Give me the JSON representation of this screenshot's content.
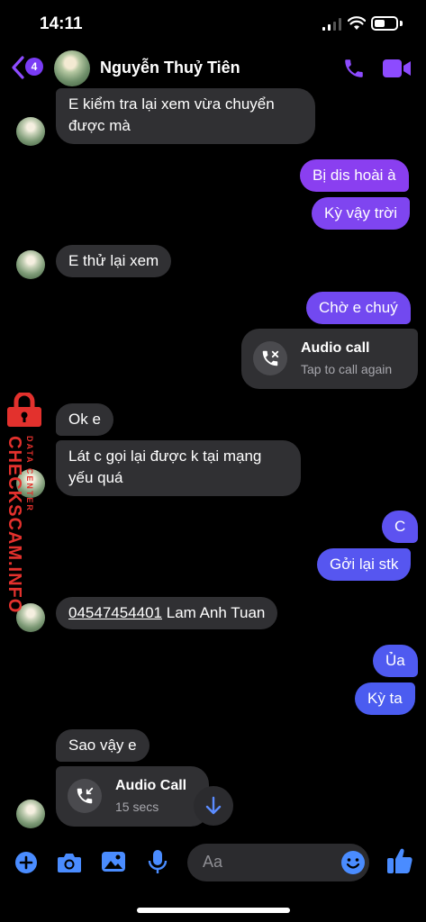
{
  "status_bar": {
    "time": "14:11"
  },
  "header": {
    "back_badge": "4",
    "contact_name": "Nguyễn Thuỷ Tiên"
  },
  "messages": {
    "m1_line1": "E kiểm tra lại xem vừa chuyển",
    "m1_line2": "được mà",
    "m2": "Bị dis hoài à",
    "m3": "Kỳ vậy trời",
    "m4": "E thử lại xem",
    "m5": "Chờ e chuý",
    "call1_title": "Audio call",
    "call1_sub": "Tap to call again",
    "m6": "Ok e",
    "m7_line1": "Lát c gọi lại được k tại mạng",
    "m7_line2": "yếu quá",
    "m8": "C",
    "m9": "Gởi lại stk",
    "m10_number": "04547454401",
    "m10_name": " Lam Anh Tuan",
    "m11": "Ủa",
    "m12": "Kỳ ta",
    "m13": "Sao vậy e",
    "call2_title": "Audio Call",
    "call2_sub": "15 secs"
  },
  "watermark": {
    "main": "CHECKSCAM.INFO",
    "small": "DATA CENTER"
  },
  "composer": {
    "placeholder": "Aa"
  },
  "colors": {
    "outgoing_top": "#8a3ff0",
    "outgoing_bottom": "#4b5cf0",
    "incoming": "#303033",
    "accent": "#8d4bff"
  }
}
